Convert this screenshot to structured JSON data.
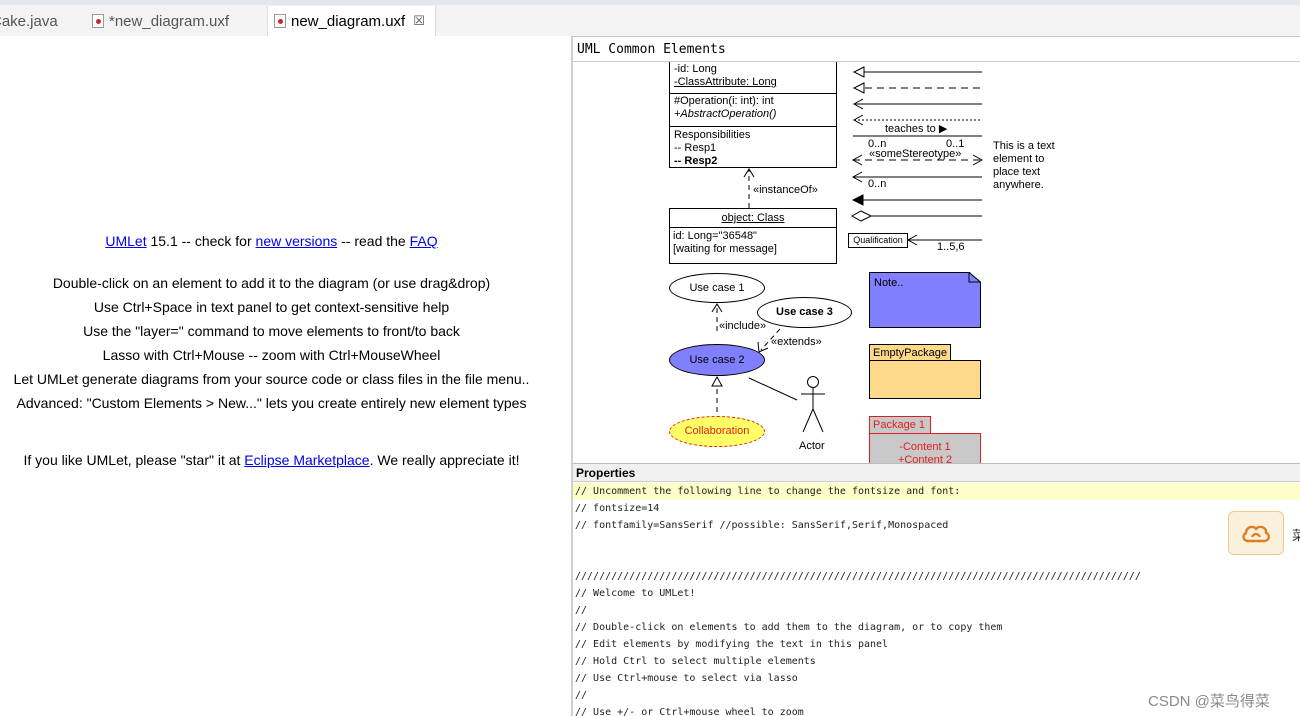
{
  "tabs": [
    {
      "label": "Cake.java",
      "active": false
    },
    {
      "label": "*new_diagram.uxf",
      "active": false
    },
    {
      "label": "new_diagram.uxf",
      "active": true
    }
  ],
  "welcome": {
    "line1": {
      "umlet_link": "UMLet",
      "version_text": " 15.1 -- check for ",
      "versions_link": "new versions",
      "read_text": " -- read the ",
      "faq_link": "FAQ"
    },
    "tips": [
      "Double-click on an element to add it to the diagram (or use drag&drop)",
      "Use Ctrl+Space in text panel to get context-sensitive help",
      "Use the \"layer=\" command to move elements to front/to back",
      "Lasso with Ctrl+Mouse -- zoom with Ctrl+MouseWheel",
      "Let UMLet generate diagrams from your source code or class files in the file menu..",
      "Advanced: \"Custom Elements > New...\" lets you create entirely new element types"
    ],
    "star": {
      "prefix": "If you like UMLet, please \"star\" it at ",
      "link": "Eclipse Marketplace",
      "suffix": ". We really appreciate it!"
    }
  },
  "palette": {
    "title": "UML Common Elements",
    "class_box": {
      "attributes": [
        "-id: Long",
        "-ClassAttribute: Long"
      ],
      "operations": [
        "#Operation(i: int): int",
        "+AbstractOperation()"
      ],
      "responsibilities": [
        "Responsibilities",
        "-- Resp1",
        "-- Resp2"
      ]
    },
    "instance_of": "«instanceOf»",
    "object_box": {
      "title": "object: Class",
      "lines": [
        "id: Long=\"36548\"",
        "[waiting for message]"
      ]
    },
    "relations": {
      "teaches": "teaches to",
      "mult_left": "0..n",
      "mult_right": "0..1",
      "stereotype": "«someStereotype»",
      "mult_bottom": "0..n",
      "qualification": "Qualification",
      "qual_mult": "1..5,6"
    },
    "text_element": [
      "This is a text",
      "element to",
      "place text",
      "anywhere."
    ],
    "use_case_1": "Use case 1",
    "use_case_3": "Use case 3",
    "use_case_2": "Use case 2",
    "include": "«include»",
    "extends": "«extends»",
    "collaboration": "Collaboration",
    "actor": "Actor",
    "note": "Note..",
    "empty_package": "EmptyPackage",
    "package1": {
      "title": "Package 1",
      "contents": [
        "-Content 1",
        "+Content 2"
      ]
    },
    "colors": {
      "note": "#8080ff",
      "package": "#ffd98a",
      "package1_fill": "#c8c8c8",
      "package1_accent": "#e02020",
      "use_case_2": "#8080ff",
      "collaboration": "#ffff66"
    }
  },
  "properties": {
    "title": "Properties",
    "lines": [
      "// Uncomment the following line to change the fontsize and font:",
      "// fontsize=14",
      "// fontfamily=SansSerif //possible: SansSerif,Serif,Monospaced",
      "",
      "",
      "//////////////////////////////////////////////////////////////////////////////////////////////",
      "// Welcome to UMLet!",
      "//",
      "// Double-click on elements to add them to the diagram, or to copy them",
      "// Edit elements by modifying the text in this panel",
      "// Hold Ctrl to select multiple elements",
      "// Use Ctrl+mouse to select via lasso",
      "//",
      "// Use +/- or Ctrl+mouse wheel to zoom"
    ]
  },
  "side_widget": {
    "icon": "cloud-icon",
    "edge_text": "菜"
  },
  "watermark": "CSDN @菜鸟得菜"
}
